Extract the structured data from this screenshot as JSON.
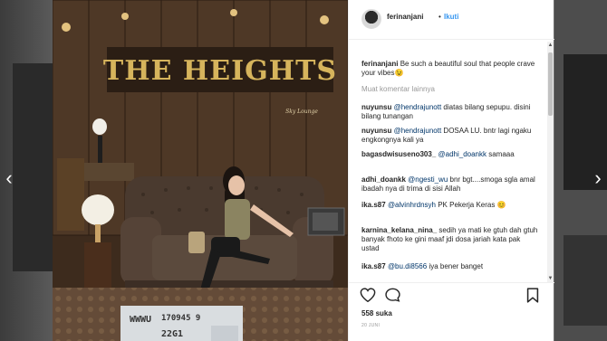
{
  "header": {
    "username": "ferinanjani",
    "separator": "•",
    "follow_label": "Ikuti"
  },
  "photo": {
    "sign_text": "THE HEIGHTS",
    "sign_subtitle": "Sky Lounge",
    "plate_text_1": "WWWU",
    "plate_text_2": "170945 9",
    "plate_text_3": "22G1"
  },
  "caption": {
    "username": "ferinanjani",
    "text": "Be such a beautiful soul that people crave your vibes😉"
  },
  "more_comments_label": "Muat komentar lainnya",
  "comments": [
    {
      "user": "nuyunsu",
      "mention": "@hendrajunott",
      "text": "diatas bilang sepupu. disini bilang tunangan"
    },
    {
      "user": "nuyunsu",
      "mention": "@hendrajunott",
      "text": "DOSAA LU. bntr lagi ngaku engkongnya kali ya"
    },
    {
      "user": "bagasdwisuseno303_",
      "mention": "@adhi_doankk",
      "text": "samaaa"
    },
    {
      "user": "adhi_doankk",
      "mention": "@ngesti_wu",
      "text": "bnr bgt....smoga sgla amal ibadah nya di trima di sisi Allah"
    },
    {
      "user": "ika.s87",
      "mention": "@alvinhrdnsyh",
      "text": "PK Pekerja Keras 😊"
    },
    {
      "user": "karnina_kelana_nina_",
      "mention": "",
      "text": "sedih ya mati ke gtuh dah gtuh banyak fhoto ke gini maaf jdi dosa jariah kata pak ustad"
    },
    {
      "user": "ika.s87",
      "mention": "@bu.di8566",
      "text": "iya bener banget"
    }
  ],
  "likes_label": "558 suka",
  "date_label": "20 JUNI",
  "icons": {
    "like": "heart-icon",
    "comment": "comment-icon",
    "save": "bookmark-icon",
    "prev": "chevron-left-icon",
    "next": "chevron-right-icon"
  },
  "navigation": {
    "prev_glyph": "‹",
    "next_glyph": "›"
  },
  "colors": {
    "link_blue": "#3897f0",
    "text": "#262626",
    "muted": "#999999"
  }
}
